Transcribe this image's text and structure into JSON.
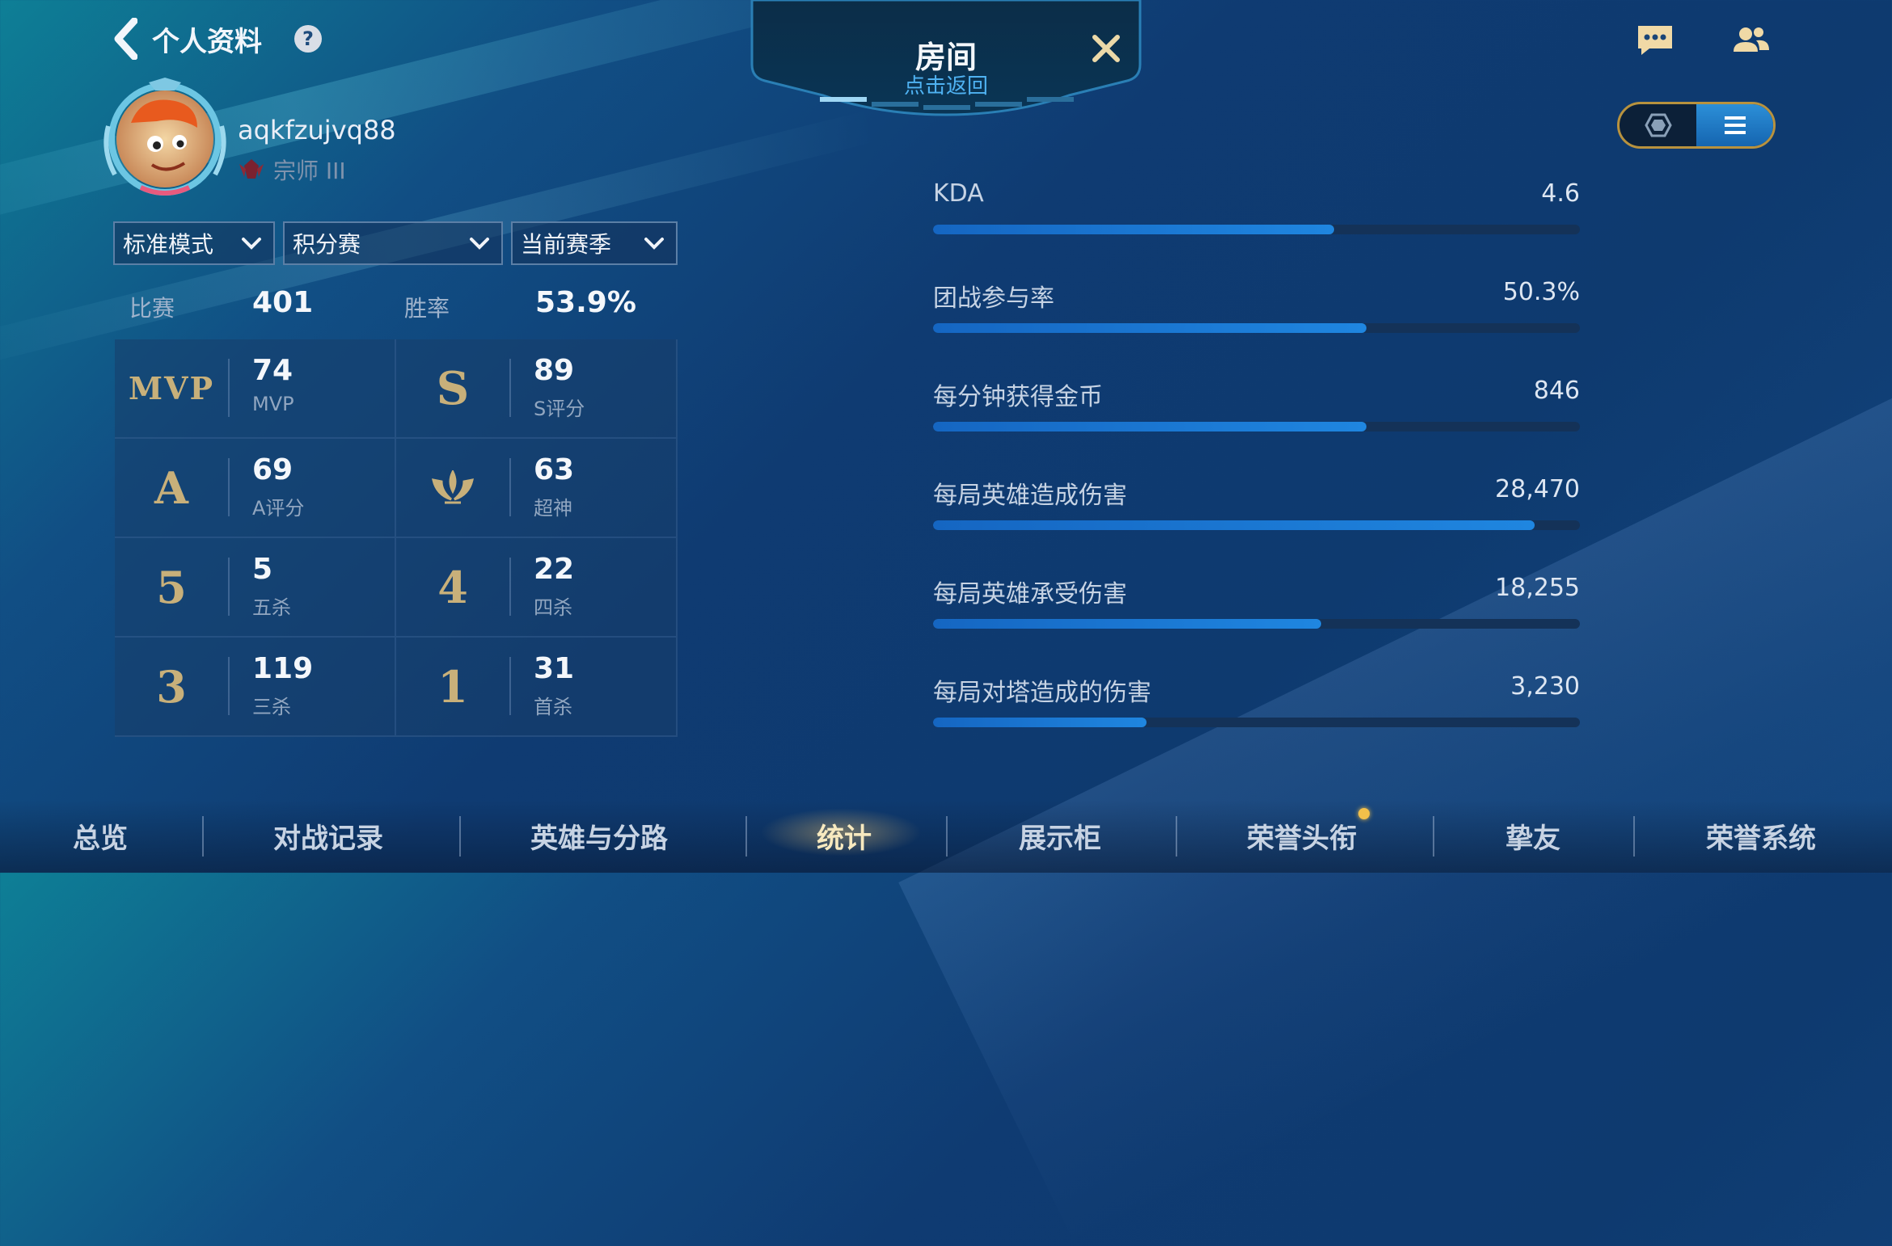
{
  "header": {
    "title": "个人资料",
    "help_icon": "question-icon"
  },
  "room": {
    "title": "房间",
    "subtitle": "点击返回"
  },
  "profile": {
    "username": "aqkfzujvq88",
    "rank": "宗师 III"
  },
  "filters": [
    {
      "label": "标准模式"
    },
    {
      "label": "积分赛"
    },
    {
      "label": "当前赛季"
    }
  ],
  "summary": {
    "matches_label": "比赛",
    "matches_value": "401",
    "winrate_label": "胜率",
    "winrate_value": "53.9%"
  },
  "stats": [
    {
      "badge": "MVP",
      "value": "74",
      "label": "MVP"
    },
    {
      "badge": "S",
      "value": "89",
      "label": "S评分"
    },
    {
      "badge": "A",
      "value": "69",
      "label": "A评分"
    },
    {
      "badge": "crown-icon",
      "value": "63",
      "label": "超神"
    },
    {
      "badge": "5",
      "value": "5",
      "label": "五杀"
    },
    {
      "badge": "4",
      "value": "22",
      "label": "四杀"
    },
    {
      "badge": "3",
      "value": "119",
      "label": "三杀"
    },
    {
      "badge": "1",
      "value": "31",
      "label": "首杀"
    }
  ],
  "metrics": [
    {
      "label": "KDA",
      "value": "4.6",
      "fill": 0.62
    },
    {
      "label": "团战参与率",
      "value": "50.3%",
      "fill": 0.67
    },
    {
      "label": "每分钟获得金币",
      "value": "846",
      "fill": 0.67
    },
    {
      "label": "每局英雄造成伤害",
      "value": "28,470",
      "fill": 0.93
    },
    {
      "label": "每局英雄承受伤害",
      "value": "18,255",
      "fill": 0.6
    },
    {
      "label": "每局对塔造成的伤害",
      "value": "3,230",
      "fill": 0.33
    }
  ],
  "bottom_nav": [
    {
      "label": "总览"
    },
    {
      "label": "对战记录"
    },
    {
      "label": "英雄与分路"
    },
    {
      "label": "统计"
    },
    {
      "label": "展示柜"
    },
    {
      "label": "荣誉头衔"
    },
    {
      "label": "挚友"
    },
    {
      "label": "荣誉系统"
    }
  ],
  "colors": {
    "accent_blue": "#1f86e0",
    "gold": "#c8b07a",
    "active_tab": "#f7e9bf"
  }
}
